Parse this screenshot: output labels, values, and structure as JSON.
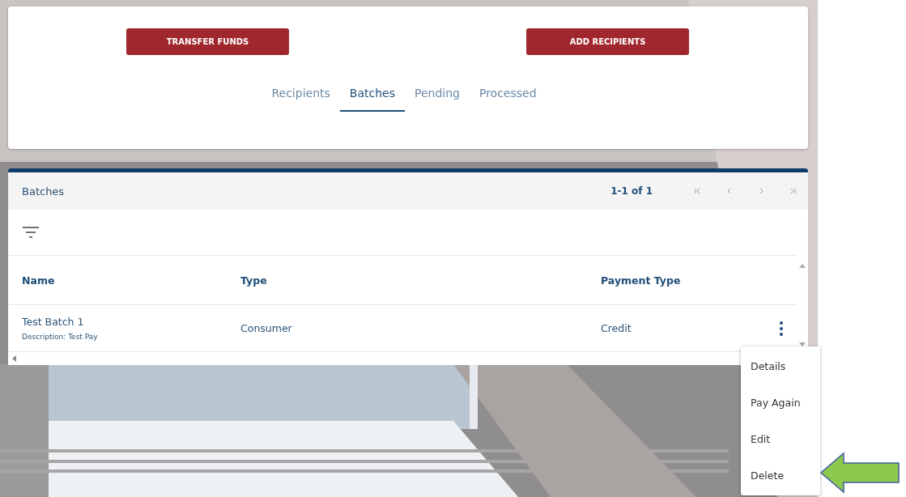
{
  "actions": [
    "TRANSFER FUNDS",
    "ADD RECIPIENTS"
  ],
  "tabs": [
    {
      "label": "Recipients",
      "selected": false
    },
    {
      "label": "Batches",
      "selected": true
    },
    {
      "label": "Pending",
      "selected": false
    },
    {
      "label": "Processed",
      "selected": false
    }
  ],
  "table": {
    "title": "Batches",
    "range": "1-1 of 1",
    "columns": [
      "Name",
      "Type",
      "Payment Type"
    ],
    "rows": [
      {
        "name": "Test Batch 1",
        "description": "Description: Test Pay",
        "type": "Consumer",
        "payment_type": "Credit"
      }
    ]
  },
  "menu": {
    "items": [
      "Details",
      "Pay Again",
      "Edit",
      "Delete"
    ]
  },
  "background": {
    "kind": "picture"
  }
}
